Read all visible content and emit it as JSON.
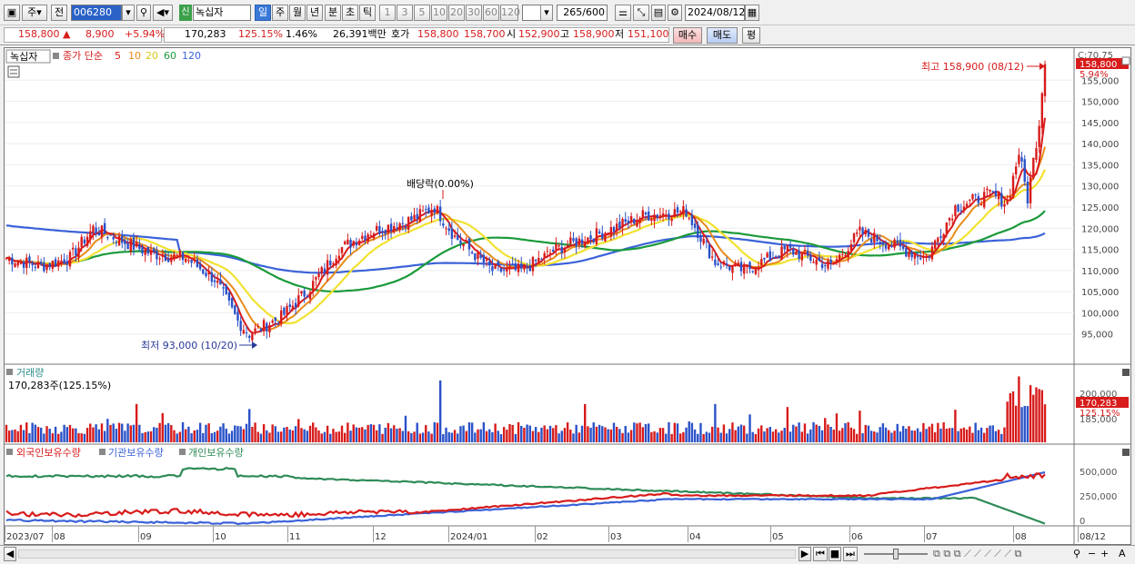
{
  "toolbar": {
    "market_type": "주",
    "prev_label": "전",
    "stock_code": "006280",
    "new_badge": "신",
    "stock_name": "녹십자",
    "periods": [
      "일",
      "주",
      "월",
      "년",
      "분",
      "초",
      "틱"
    ],
    "selected_period": "일",
    "intervals": [
      "1",
      "3",
      "5",
      "10",
      "20",
      "30",
      "60",
      "120"
    ],
    "count": "265",
    "count_total": "/600",
    "date": "2024/08/12"
  },
  "quote": {
    "price": "158,800",
    "arrow": "▲",
    "change": "8,900",
    "change_pct": "+5.94%",
    "volume": "170,283",
    "volume_ratio": "125.15%",
    "turnover_pct": "1.46%",
    "amount": "26,391백만",
    "bid_label": "호가",
    "ask": "158,800",
    "bid": "158,700",
    "open_label": "시",
    "open": "152,900",
    "high_label": "고",
    "high": "158,900",
    "low_label": "저",
    "low": "151,100",
    "buy_label": "매수",
    "sell_label": "매도",
    "avg_label": "평"
  },
  "price_panel": {
    "name_tag": "녹십자",
    "legend_prefix": "종가 단순",
    "ma_labels": [
      "5",
      "10",
      "20",
      "60",
      "120"
    ],
    "ma_colors": [
      "#d81b1b",
      "#e88c1a",
      "#f2e230",
      "#1a9a3a",
      "#3a62d8"
    ],
    "top_label": "C:70.75",
    "current_tag": "158,800",
    "current_pct": "5.94%",
    "high_note": "최고 158,900 (08/12)",
    "low_note": "최저 93,000 (10/20)",
    "dividend_note": "배당락(0.00%)",
    "y_ticks": [
      "155,000",
      "150,000",
      "145,000",
      "140,000",
      "135,000",
      "130,000",
      "125,000",
      "120,000",
      "115,000",
      "110,000",
      "105,000",
      "100,000",
      "95,000"
    ]
  },
  "volume_panel": {
    "title": "거래량",
    "value_note": "170,283주(125.15%)",
    "y_ticks": [
      "200,000",
      "185,000"
    ],
    "tag": "170,283",
    "tag_pct": "125.15%"
  },
  "holdings_panel": {
    "series": [
      "외국인보유수량",
      "기관보유수량",
      "개인보유수량"
    ],
    "colors": [
      "#d81b1b",
      "#3a62d8",
      "#2e8b57"
    ],
    "y_ticks": [
      "500,000",
      "250,000",
      "0"
    ]
  },
  "x_axis": [
    "2023/07",
    "08",
    "09",
    "10",
    "11",
    "12",
    "2024/01",
    "02",
    "03",
    "04",
    "05",
    "06",
    "07",
    "08",
    "08/12"
  ],
  "chart_data": {
    "type": "line",
    "price_anchors": [
      {
        "x": 0,
        "y": 113000
      },
      {
        "x": 12,
        "y": 111000
      },
      {
        "x": 22,
        "y": 113000
      },
      {
        "x": 30,
        "y": 120000
      },
      {
        "x": 40,
        "y": 117000
      },
      {
        "x": 50,
        "y": 114000
      },
      {
        "x": 62,
        "y": 113000
      },
      {
        "x": 72,
        "y": 108000
      },
      {
        "x": 80,
        "y": 98000
      },
      {
        "x": 84,
        "y": 95000
      },
      {
        "x": 95,
        "y": 99000
      },
      {
        "x": 105,
        "y": 106000
      },
      {
        "x": 115,
        "y": 115000
      },
      {
        "x": 125,
        "y": 119000
      },
      {
        "x": 140,
        "y": 122000
      },
      {
        "x": 148,
        "y": 125000
      },
      {
        "x": 155,
        "y": 118000
      },
      {
        "x": 168,
        "y": 110000
      },
      {
        "x": 178,
        "y": 110000
      },
      {
        "x": 190,
        "y": 115000
      },
      {
        "x": 210,
        "y": 120000
      },
      {
        "x": 220,
        "y": 123000
      },
      {
        "x": 235,
        "y": 124000
      },
      {
        "x": 245,
        "y": 112000
      },
      {
        "x": 255,
        "y": 110000
      },
      {
        "x": 270,
        "y": 115000
      },
      {
        "x": 285,
        "y": 111000
      },
      {
        "x": 295,
        "y": 119000
      },
      {
        "x": 310,
        "y": 115000
      },
      {
        "x": 318,
        "y": 113000
      },
      {
        "x": 328,
        "y": 125000
      },
      {
        "x": 340,
        "y": 128000
      },
      {
        "x": 346,
        "y": 126000
      },
      {
        "x": 350,
        "y": 138000
      },
      {
        "x": 353,
        "y": 127000
      },
      {
        "x": 357,
        "y": 145000
      },
      {
        "x": 359,
        "y": 158800
      }
    ],
    "y_range": [
      90000,
      160000
    ],
    "x_count": 360,
    "high": 158900,
    "low": 93000
  }
}
